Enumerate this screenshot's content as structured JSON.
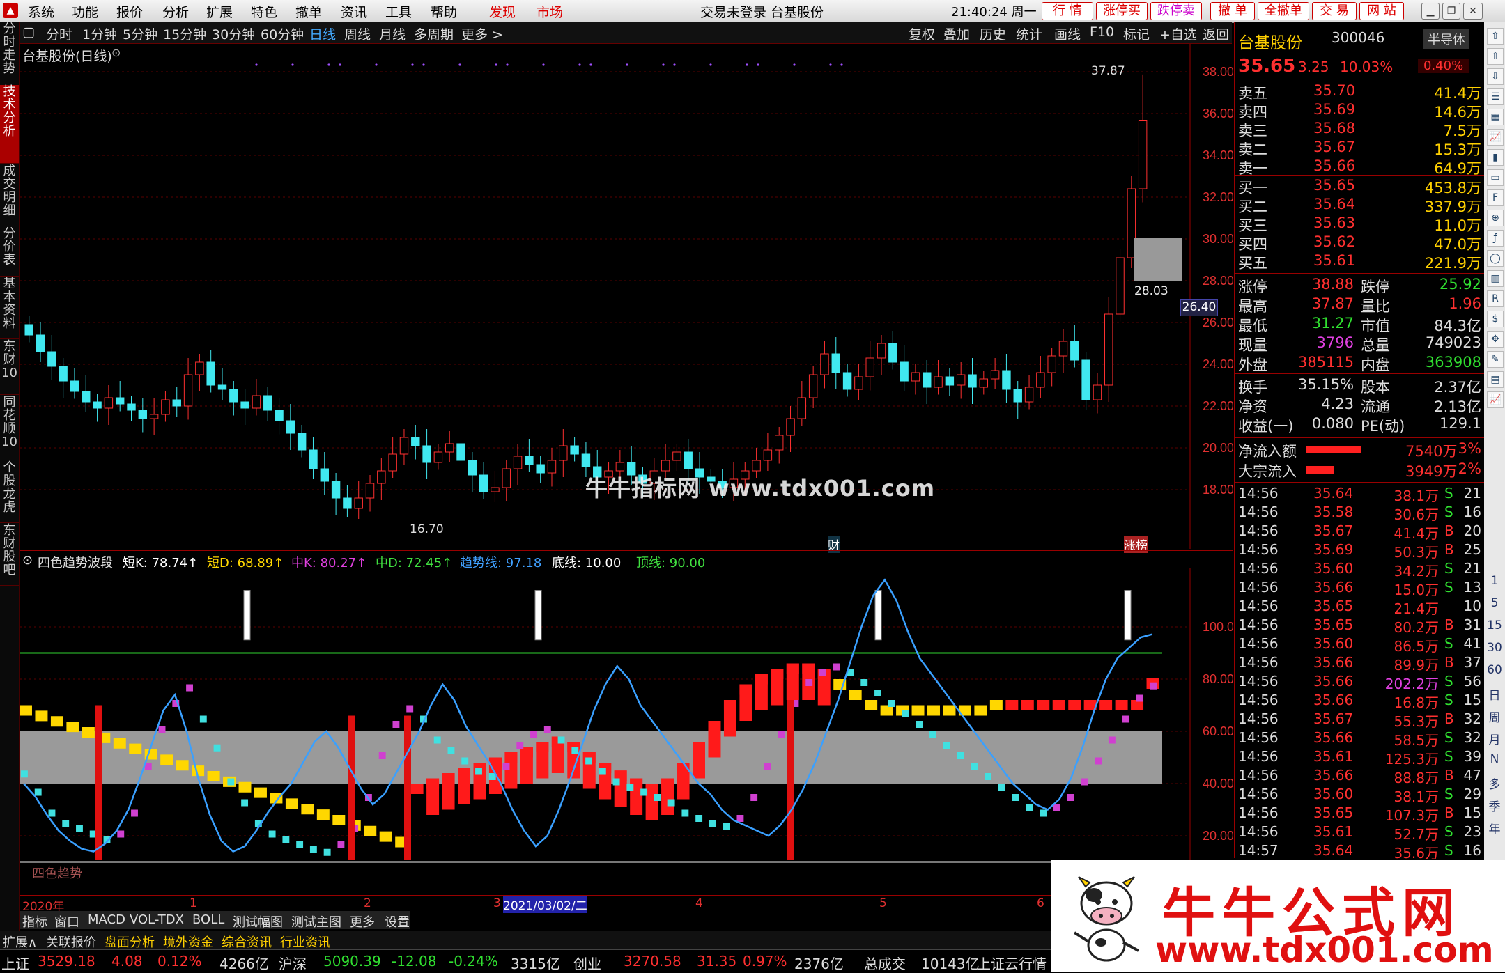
{
  "menubar": {
    "items": [
      "系统",
      "功能",
      "报价",
      "分析",
      "扩展",
      "特色",
      "撤单",
      "资讯",
      "工具",
      "帮助"
    ],
    "red_items": [
      "发现",
      "市场"
    ],
    "center_text": "交易未登录  台基股份",
    "clock": "21:40:24 周一",
    "right_buttons": [
      "行 情",
      "涨停买",
      "跌停卖",
      "撤 单",
      "全撤单",
      "交 易",
      "网 站"
    ]
  },
  "left_tabs": [
    "分时走势",
    "技术分析",
    "成交明细",
    "分价表",
    "基本资料",
    "东财10",
    "同花顺10",
    "个股龙虎",
    "东财股吧"
  ],
  "left_tab_active": "技术分析",
  "chart_toolbar": {
    "periods": [
      "分时",
      "1分钟",
      "5分钟",
      "15分钟",
      "30分钟",
      "60分钟",
      "日线",
      "周线",
      "月线",
      "多周期",
      "更多 >"
    ],
    "active": "日线",
    "tools": [
      "复权",
      "叠加",
      "历史",
      "统计",
      "画线",
      "F10",
      "标记",
      "+自选",
      "返回"
    ]
  },
  "price_panel": {
    "title": "台基股份(日线)",
    "high_label": "37.87",
    "low_label": "16.70",
    "cursor_value": "28.03",
    "current_marker": "26.40",
    "watermark": "牛牛指标网 www.tdx001.com",
    "event_tags": [
      "财",
      "涨榜"
    ]
  },
  "indicator_panel": {
    "name": "四色趋势波段",
    "values": [
      {
        "label": "短K: 78.74",
        "color": "#ffffff"
      },
      {
        "label": "短D: 68.89",
        "color": "#ffd700"
      },
      {
        "label": "中K: 80.27",
        "color": "#e040e0"
      },
      {
        "label": "中D: 72.45",
        "color": "#40e040"
      },
      {
        "label": "趋势线: 97.18",
        "color": "#40a0ff"
      },
      {
        "label": "底线: 10.00",
        "color": "#ffffff"
      },
      {
        "label": "顶线: 90.00",
        "color": "#40e040"
      }
    ],
    "bottom_label": "四色趋势",
    "y_ticks": [
      "100.0",
      "80.00",
      "60.00",
      "40.00",
      "20.00"
    ]
  },
  "date_bar": {
    "labels": [
      "2020年",
      "1",
      "2",
      "3",
      "4",
      "5",
      "6"
    ],
    "highlight": "2021/03/02/二"
  },
  "bottom_tabs": [
    "指标",
    "窗口",
    "MACD",
    "VOL-TDX",
    "BOLL",
    "测试幅图",
    "测试主图",
    "更多",
    "设置"
  ],
  "ext_tabs": [
    "扩展∧",
    "关联报价",
    "盘面分析",
    "境外资金",
    "综合资讯",
    "行业资讯"
  ],
  "status_bar": [
    {
      "t": "上证",
      "c": "#ddd"
    },
    {
      "t": "3529.18",
      "c": "#ff3030"
    },
    {
      "t": "4.08",
      "c": "#ff3030"
    },
    {
      "t": "0.12%",
      "c": "#ff3030"
    },
    {
      "t": "4266亿",
      "c": "#ddd"
    },
    {
      "t": "沪深",
      "c": "#ddd"
    },
    {
      "t": "5090.39",
      "c": "#30e030"
    },
    {
      "t": "-12.08",
      "c": "#30e030"
    },
    {
      "t": "-0.24%",
      "c": "#30e030"
    },
    {
      "t": "3315亿",
      "c": "#ddd"
    },
    {
      "t": "创业",
      "c": "#ddd"
    },
    {
      "t": "3270.58",
      "c": "#ff3030"
    },
    {
      "t": "31.35",
      "c": "#ff3030"
    },
    {
      "t": "0.97%",
      "c": "#ff3030"
    },
    {
      "t": "2376亿",
      "c": "#ddd"
    },
    {
      "t": "总成交",
      "c": "#ddd"
    },
    {
      "t": "10143亿",
      "c": "#ddd"
    },
    {
      "t": "上证云行情",
      "c": "#ddd"
    }
  ],
  "quote": {
    "name": "台基股份",
    "code": "300046",
    "sector": "半导体",
    "price": "35.65",
    "change": "3.25",
    "pct": "10.03%",
    "extra_pct": "0.40%",
    "asks": [
      {
        "label": "卖五",
        "price": "35.70",
        "vol": "41.4万"
      },
      {
        "label": "卖四",
        "price": "35.69",
        "vol": "14.6万"
      },
      {
        "label": "卖三",
        "price": "35.68",
        "vol": "7.5万"
      },
      {
        "label": "卖二",
        "price": "35.67",
        "vol": "15.3万"
      },
      {
        "label": "卖一",
        "price": "35.66",
        "vol": "64.9万"
      }
    ],
    "bids": [
      {
        "label": "买一",
        "price": "35.65",
        "vol": "453.8万"
      },
      {
        "label": "买二",
        "price": "35.64",
        "vol": "337.9万"
      },
      {
        "label": "买三",
        "price": "35.63",
        "vol": "11.0万"
      },
      {
        "label": "买四",
        "price": "35.62",
        "vol": "47.0万"
      },
      {
        "label": "买五",
        "price": "35.61",
        "vol": "221.9万"
      }
    ],
    "stats": [
      {
        "l1": "涨停",
        "v1": "38.88",
        "c1": "#ff3030",
        "l2": "跌停",
        "v2": "25.92",
        "c2": "#30e030"
      },
      {
        "l1": "最高",
        "v1": "37.87",
        "c1": "#ff3030",
        "l2": "量比",
        "v2": "1.96",
        "c2": "#ff3030"
      },
      {
        "l1": "最低",
        "v1": "31.27",
        "c1": "#30e030",
        "l2": "市值",
        "v2": "84.3亿",
        "c2": "#ddd"
      },
      {
        "l1": "现量",
        "v1": "3796",
        "c1": "#e040e0",
        "l2": "总量",
        "v2": "749023",
        "c2": "#ddd"
      },
      {
        "l1": "外盘",
        "v1": "385115",
        "c1": "#ff3030",
        "l2": "内盘",
        "v2": "363908",
        "c2": "#30e030"
      }
    ],
    "stats2": [
      {
        "l1": "换手",
        "v1": "35.15%",
        "c1": "#ddd",
        "l2": "股本",
        "v2": "2.37亿",
        "c2": "#ddd"
      },
      {
        "l1": "净资",
        "v1": "4.23",
        "c1": "#ddd",
        "l2": "流通",
        "v2": "2.13亿",
        "c2": "#ddd"
      },
      {
        "l1": "收益(一)",
        "v1": "0.080",
        "c1": "#ddd",
        "l2": "PE(动)",
        "v2": "129.1",
        "c2": "#ddd"
      }
    ],
    "flows": [
      {
        "label": "净流入额",
        "value": "7540万",
        "pct": "3%",
        "fill": 0.6
      },
      {
        "label": "大宗流入",
        "value": "3949万",
        "pct": "2%",
        "fill": 0.3
      }
    ],
    "ticks": [
      {
        "time": "14:56",
        "price": "35.64",
        "vol": "38.1万",
        "bs": "S",
        "n": "21",
        "pc": "#ff3030",
        "vc": "#ff3030"
      },
      {
        "time": "14:56",
        "price": "35.58",
        "vol": "30.6万",
        "bs": "S",
        "n": "16",
        "pc": "#ff3030",
        "vc": "#ff3030"
      },
      {
        "time": "14:56",
        "price": "35.67",
        "vol": "41.4万",
        "bs": "B",
        "n": "20",
        "pc": "#ff3030",
        "vc": "#ff3030"
      },
      {
        "time": "14:56",
        "price": "35.69",
        "vol": "50.3万",
        "bs": "B",
        "n": "25",
        "pc": "#ff3030",
        "vc": "#ff3030"
      },
      {
        "time": "14:56",
        "price": "35.60",
        "vol": "34.2万",
        "bs": "S",
        "n": "21",
        "pc": "#ff3030",
        "vc": "#ff3030"
      },
      {
        "time": "14:56",
        "price": "35.66",
        "vol": "15.0万",
        "bs": "S",
        "n": "13",
        "pc": "#ff3030",
        "vc": "#ff3030"
      },
      {
        "time": "14:56",
        "price": "35.65",
        "vol": "21.4万",
        "bs": "",
        "n": "10",
        "pc": "#ff3030",
        "vc": "#ff3030"
      },
      {
        "time": "14:56",
        "price": "35.65",
        "vol": "80.2万",
        "bs": "B",
        "n": "31",
        "pc": "#ff3030",
        "vc": "#ff3030"
      },
      {
        "time": "14:56",
        "price": "35.60",
        "vol": "86.5万",
        "bs": "S",
        "n": "41",
        "pc": "#ff3030",
        "vc": "#ff3030"
      },
      {
        "time": "14:56",
        "price": "35.66",
        "vol": "89.9万",
        "bs": "B",
        "n": "37",
        "pc": "#ff3030",
        "vc": "#ff3030"
      },
      {
        "time": "14:56",
        "price": "35.66",
        "vol": "202.2万",
        "bs": "S",
        "n": "56",
        "pc": "#ff3030",
        "vc": "#e040e0"
      },
      {
        "time": "14:56",
        "price": "35.66",
        "vol": "16.8万",
        "bs": "S",
        "n": "15",
        "pc": "#ff3030",
        "vc": "#ff3030"
      },
      {
        "time": "14:56",
        "price": "35.67",
        "vol": "55.3万",
        "bs": "B",
        "n": "32",
        "pc": "#ff3030",
        "vc": "#ff3030"
      },
      {
        "time": "14:56",
        "price": "35.66",
        "vol": "58.5万",
        "bs": "S",
        "n": "32",
        "pc": "#ff3030",
        "vc": "#ff3030"
      },
      {
        "time": "14:56",
        "price": "35.61",
        "vol": "125.3万",
        "bs": "S",
        "n": "39",
        "pc": "#ff3030",
        "vc": "#ff3030"
      },
      {
        "time": "14:56",
        "price": "35.66",
        "vol": "88.8万",
        "bs": "B",
        "n": "47",
        "pc": "#ff3030",
        "vc": "#ff3030"
      },
      {
        "time": "14:56",
        "price": "35.60",
        "vol": "38.1万",
        "bs": "S",
        "n": "29",
        "pc": "#ff3030",
        "vc": "#ff3030"
      },
      {
        "time": "14:56",
        "price": "35.65",
        "vol": "107.3万",
        "bs": "B",
        "n": "15",
        "pc": "#ff3030",
        "vc": "#ff3030"
      },
      {
        "time": "14:56",
        "price": "35.61",
        "vol": "52.7万",
        "bs": "S",
        "n": "23",
        "pc": "#ff3030",
        "vc": "#ff3030"
      },
      {
        "time": "14:57",
        "price": "35.64",
        "vol": "35.6万",
        "bs": "S",
        "n": "16",
        "pc": "#ff3030",
        "vc": "#ff3030"
      }
    ]
  },
  "icon_strip": [
    "arrow-up-icon",
    "arrow-up-icon",
    "arrow-down-icon",
    "list-icon",
    "grid-icon",
    "chart-icon",
    "kline-icon",
    "window-icon",
    "f10-icon",
    "zoom-icon",
    "f-icon",
    "circle-icon",
    "bar-icon",
    "rsi-icon",
    "money-icon",
    "move-icon",
    "pen-icon",
    "fs-icon",
    "chart-icon"
  ],
  "icon_strip_text": [
    "1",
    "5",
    "15",
    "30",
    "60",
    "日",
    "周",
    "月",
    "N",
    "多",
    "季",
    "年"
  ],
  "ad": {
    "title": "牛牛公式网",
    "url": "www.tdx001.com"
  },
  "chart_data": [
    {
      "type": "candlestick",
      "title": "台基股份(日线)",
      "ylim": [
        16,
        39
      ],
      "y_ticks": [
        18,
        20,
        22,
        24,
        26,
        28,
        30,
        32,
        34,
        36,
        38
      ],
      "candles_close": [
        25.4,
        24.6,
        23.9,
        23.2,
        22.7,
        22.2,
        21.9,
        22.4,
        22.1,
        21.8,
        21.4,
        21.6,
        22.3,
        22.0,
        23.5,
        24.1,
        23.0,
        22.8,
        22.2,
        21.9,
        22.5,
        21.8,
        21.3,
        20.7,
        19.9,
        19.0,
        18.4,
        17.6,
        17.1,
        17.6,
        18.3,
        18.9,
        19.7,
        20.5,
        20.1,
        19.3,
        19.8,
        20.2,
        19.4,
        18.7,
        17.9,
        18.1,
        19.0,
        19.6,
        19.2,
        18.8,
        19.4,
        20.1,
        19.7,
        19.1,
        18.6,
        18.9,
        19.3,
        18.7,
        18.3,
        18.9,
        19.4,
        19.8,
        19.0,
        18.6,
        18.4,
        18.1,
        18.5,
        18.9,
        19.4,
        19.9,
        20.6,
        21.4,
        22.4,
        23.5,
        24.5,
        23.6,
        22.8,
        23.4,
        24.3,
        25.0,
        24.1,
        23.2,
        23.6,
        22.9,
        23.4,
        23.0,
        23.5,
        22.9,
        23.3,
        23.7,
        22.8,
        22.2,
        22.9,
        23.6,
        24.4,
        25.1,
        24.2,
        22.3,
        23.0,
        26.4,
        29.1,
        32.4,
        35.65
      ],
      "high": 37.87,
      "low": 16.7
    },
    {
      "type": "line",
      "title": "四色趋势波段",
      "ylim": [
        0,
        120
      ],
      "y_ticks": [
        20,
        40,
        60,
        80,
        100
      ],
      "series": [
        {
          "name": "趋势线",
          "values": [
            40,
            35,
            28,
            22,
            18,
            15,
            14,
            17,
            22,
            30,
            42,
            55,
            68,
            74,
            60,
            42,
            28,
            18,
            14,
            16,
            22,
            29,
            35,
            40,
            48,
            56,
            60,
            54,
            46,
            38,
            32,
            36,
            44,
            52,
            60,
            70,
            78,
            72,
            62,
            55,
            48,
            40,
            30,
            22,
            16,
            20,
            30,
            42,
            55,
            68,
            78,
            85,
            80,
            70,
            64,
            58,
            52,
            46,
            40,
            36,
            30,
            26,
            24,
            22,
            20,
            24,
            30,
            38,
            48,
            60,
            72,
            86,
            100,
            112,
            118,
            110,
            98,
            88,
            82,
            76,
            70,
            64,
            58,
            52,
            46,
            40,
            36,
            32,
            30,
            34,
            42,
            54,
            68,
            80,
            88,
            92,
            96,
            97.18
          ]
        },
        {
          "name": "短K",
          "values": [
            45,
            38,
            30,
            26,
            24,
            22,
            20,
            22,
            30,
            48,
            62,
            72,
            78,
            66,
            55,
            42,
            34,
            26,
            22,
            20,
            18,
            16,
            15,
            18,
            24,
            36,
            52,
            64,
            70,
            66,
            58,
            54,
            50,
            46,
            44,
            48,
            56,
            60,
            62,
            58,
            54,
            50,
            46,
            42,
            40,
            38,
            36,
            34,
            30,
            28,
            26,
            25,
            28,
            36,
            48,
            60,
            72,
            80,
            84,
            86,
            84,
            80,
            76,
            72,
            68,
            64,
            60,
            56,
            52,
            48,
            44,
            40,
            36,
            32,
            30,
            32,
            36,
            42,
            50,
            58,
            66,
            74,
            78.74
          ]
        },
        {
          "name": "中K",
          "values": [
            20,
            18,
            17,
            16,
            15,
            15,
            16,
            17,
            18,
            19,
            20,
            21,
            22,
            23,
            24,
            24,
            25,
            26,
            27,
            28,
            30,
            32,
            34,
            36,
            38,
            40,
            42,
            44,
            46,
            48,
            50,
            52,
            54,
            56,
            58,
            56,
            52,
            48,
            45,
            42,
            40,
            42,
            48,
            56,
            64,
            72,
            78,
            82,
            84,
            86,
            86,
            84,
            80,
            76,
            72,
            70,
            70,
            70,
            70,
            70,
            70,
            70,
            72,
            72,
            72,
            72,
            72,
            72,
            72,
            72,
            72,
            72,
            80.27
          ]
        },
        {
          "name": "中D",
          "values": [
            72.45
          ]
        }
      ],
      "levels": {
        "底线": 10.0,
        "顶线": 90.0
      }
    }
  ]
}
